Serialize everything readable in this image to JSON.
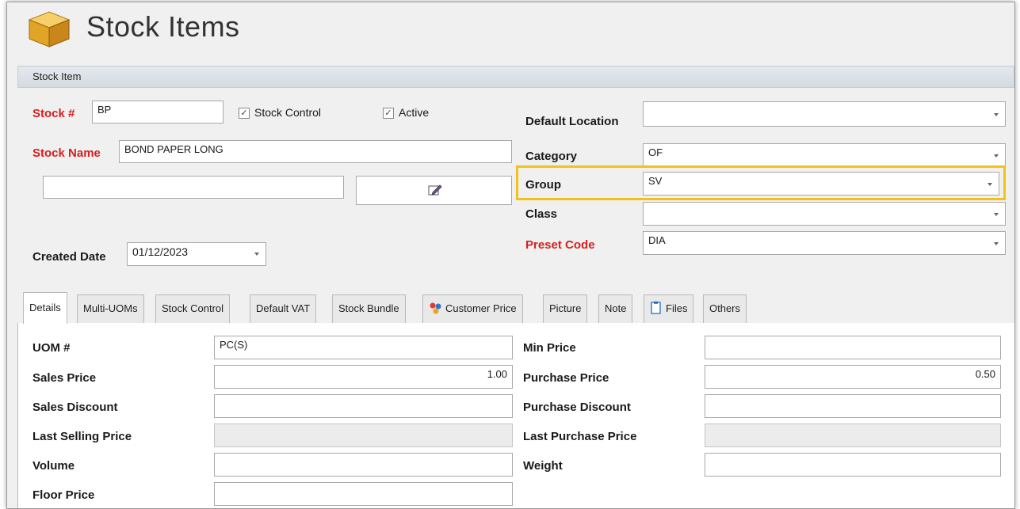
{
  "window": {
    "title": "Stock Items",
    "icon": "box-icon"
  },
  "section": {
    "label": "Stock Item"
  },
  "form": {
    "stock_no_label": "Stock #",
    "stock_no_value": "BP",
    "stock_control_label": "Stock Control",
    "stock_control_checked": true,
    "active_label": "Active",
    "active_checked": true,
    "stock_name_label": "Stock Name",
    "stock_name_value": "BOND PAPER LONG",
    "extra_field_value": "",
    "created_date_label": "Created Date",
    "created_date_value": "01/12/2023",
    "default_location_label": "Default Location",
    "default_location_value": "",
    "category_label": "Category",
    "category_value": "OF",
    "group_label": "Group",
    "group_value": "SV",
    "class_label": "Class",
    "class_value": "",
    "preset_code_label": "Preset Code",
    "preset_code_value": "DIA"
  },
  "tabs": [
    {
      "label": "Details",
      "active": true,
      "icon": ""
    },
    {
      "label": "Multi-UOMs",
      "active": false,
      "icon": ""
    },
    {
      "label": "Stock Control",
      "active": false,
      "icon": ""
    },
    {
      "label": "Default VAT",
      "active": false,
      "icon": ""
    },
    {
      "label": "Stock Bundle",
      "active": false,
      "icon": ""
    },
    {
      "label": "Customer Price",
      "active": false,
      "icon": "customer-price-icon"
    },
    {
      "label": "Picture",
      "active": false,
      "icon": ""
    },
    {
      "label": "Note",
      "active": false,
      "icon": ""
    },
    {
      "label": "Files",
      "active": false,
      "icon": "files-icon"
    },
    {
      "label": "Others",
      "active": false,
      "icon": ""
    }
  ],
  "details": {
    "uom_label": "UOM #",
    "uom_value": "PC(S)",
    "sales_price_label": "Sales Price",
    "sales_price_value": "1.00",
    "sales_discount_label": "Sales Discount",
    "sales_discount_value": "",
    "last_selling_price_label": "Last Selling Price",
    "last_selling_price_value": "",
    "volume_label": "Volume",
    "volume_value": "",
    "floor_price_label": "Floor Price",
    "floor_price_value": "",
    "min_price_label": "Min Price",
    "min_price_value": "",
    "purchase_price_label": "Purchase Price",
    "purchase_price_value": "0.50",
    "purchase_discount_label": "Purchase Discount",
    "purchase_discount_value": "",
    "last_purchase_price_label": "Last Purchase Price",
    "last_purchase_price_value": "",
    "weight_label": "Weight",
    "weight_value": ""
  },
  "colors": {
    "required": "#d52020",
    "highlight": "#f2c21b",
    "panel": "#f0f0f0"
  }
}
